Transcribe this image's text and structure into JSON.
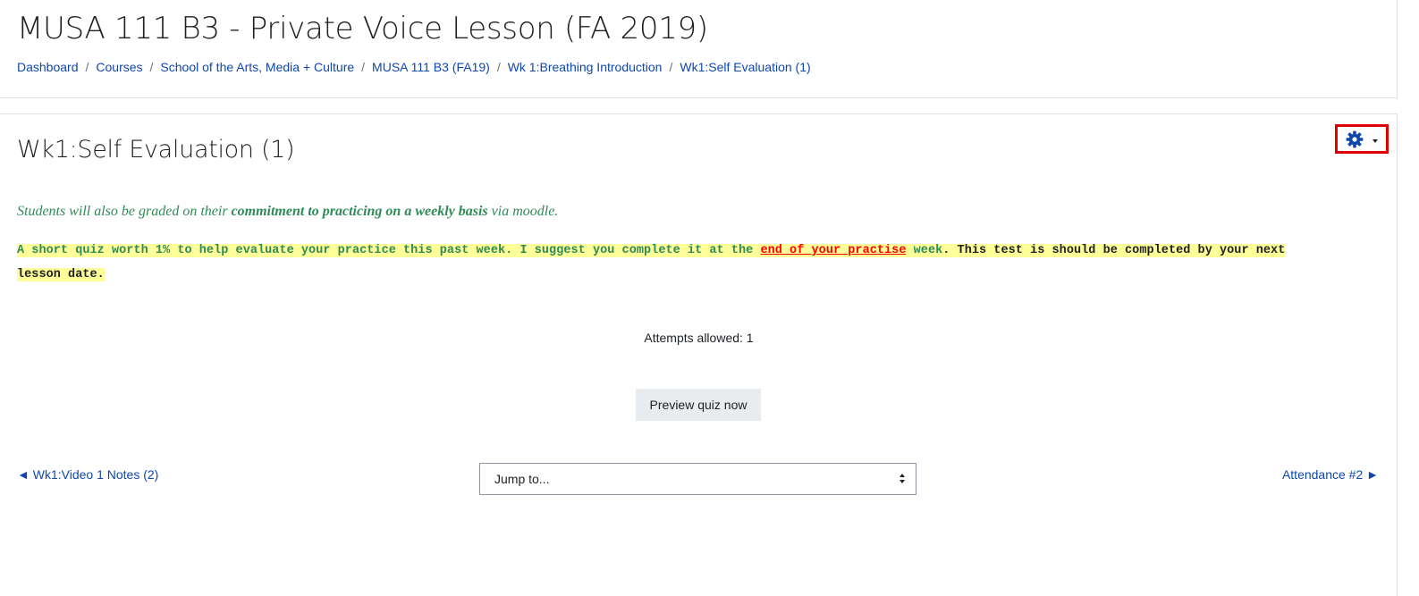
{
  "header": {
    "course_title": "MUSA 111 B3 - Private Voice Lesson (FA 2019)",
    "breadcrumb": [
      "Dashboard",
      "Courses",
      "School of the Arts, Media + Culture",
      "MUSA 111 B3 (FA19)",
      "Wk 1:Breathing Introduction",
      "Wk1:Self Evaluation (1)"
    ],
    "separator": "/"
  },
  "activity": {
    "title": "Wk1:Self Evaluation (1)",
    "settings_icon": "gear-icon",
    "intro": {
      "before": "Students will also be graded on their ",
      "bold": "commitment to practicing on a weekly basis",
      "after": " via moodle."
    },
    "description": {
      "part1": "A short quiz worth 1% to help evaluate your practice this past week. I suggest you complete it at the ",
      "red_1": "end of ",
      "red_2": "your ",
      "red_3": "practise",
      "part2": " week",
      "part3": ". This test is should be completed by your next lesson date."
    },
    "attempts_allowed": "Attempts allowed: 1",
    "preview_button": "Preview quiz now"
  },
  "navigation": {
    "prev_arrow": "◄",
    "prev_label": "Wk1:Video 1 Notes (2)",
    "next_label": "Attendance #2",
    "next_arrow": "►",
    "jump_select": "Jump to..."
  },
  "colors": {
    "link": "#0f47ad",
    "intro_text": "#2e8b57",
    "highlight": "#ffff99",
    "emphasis_red": "#ff0000",
    "settings_outline": "#e00000",
    "button_bg": "#e9ecef"
  }
}
